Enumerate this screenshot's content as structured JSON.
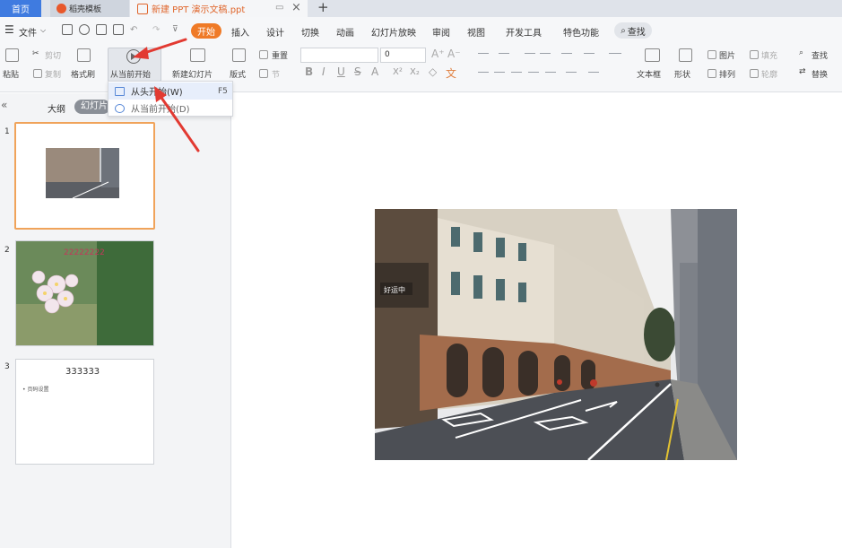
{
  "tabs": {
    "home": "首页",
    "template": "稻壳模板",
    "document": "新建 PPT 演示文稿.ppt"
  },
  "menubar": {
    "file": "文件",
    "items": [
      "开始",
      "插入",
      "设计",
      "切换",
      "动画",
      "幻灯片放映",
      "审阅",
      "视图",
      "开发工具",
      "特色功能"
    ],
    "search": "查找",
    "colors": {
      "accent": "#ef7a27"
    }
  },
  "ribbon": {
    "paste": "粘贴",
    "cut": "剪切",
    "copy": "复制",
    "format_painter": "格式刷",
    "play_from_current": "从当前开始",
    "new_slide": "新建幻灯片",
    "layout": "版式",
    "reset": "重置",
    "section": "节",
    "font_size": "0",
    "format_buttons": [
      "B",
      "I",
      "U",
      "S",
      "A",
      "X²",
      "X₂"
    ],
    "textbox": "文本框",
    "shape": "形状",
    "picture": "图片",
    "fill": "填充",
    "arrange": "排列",
    "outline": "轮廓",
    "find": "查找",
    "replace": "替换"
  },
  "dropdown": {
    "items": [
      {
        "label": "从头开始(W)",
        "shortcut": "F5"
      },
      {
        "label": "从当前开始(D)",
        "shortcut": ""
      }
    ]
  },
  "leftpanel": {
    "outline_tab": "大纲",
    "slides_tab": "幻灯片",
    "slides": [
      {
        "number": "1",
        "text": ""
      },
      {
        "number": "2",
        "text": "22222222"
      },
      {
        "number": "3",
        "title": "333333",
        "bullet": "• 页码设置"
      }
    ]
  },
  "canvas": {
    "photo_sign_text": "好运中"
  }
}
